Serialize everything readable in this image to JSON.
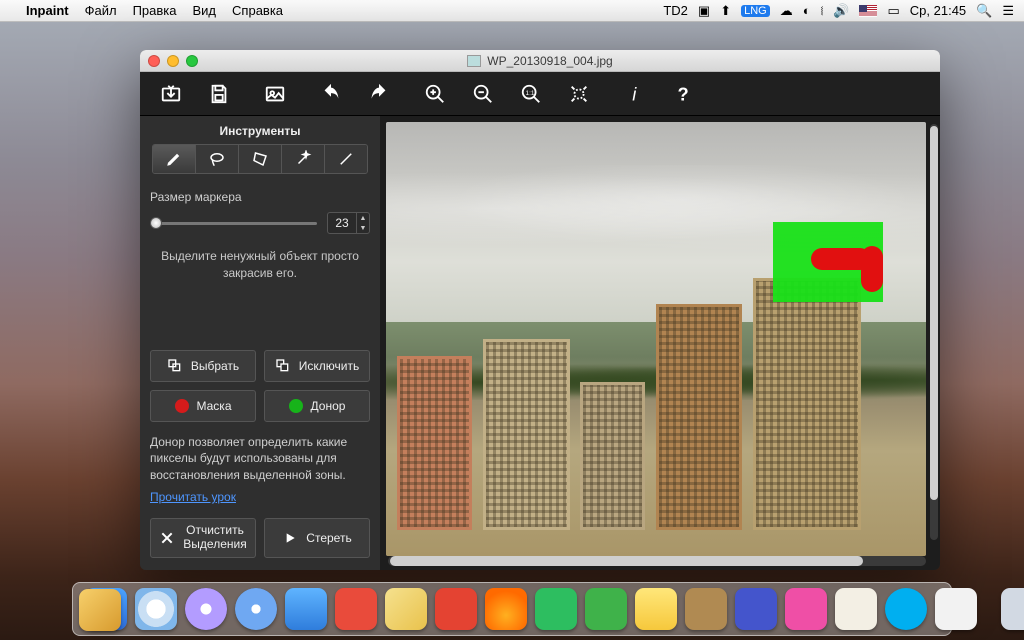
{
  "menubar": {
    "app_name": "Inpaint",
    "items": [
      "Файл",
      "Правка",
      "Вид",
      "Справка"
    ],
    "right": {
      "td2": "D2",
      "lng": "LNG",
      "clock": "Ср, 21:45"
    }
  },
  "window": {
    "title": "WP_20130918_004.jpg"
  },
  "toolbar_icons": [
    "open",
    "save",
    "export",
    "undo",
    "redo",
    "zoom-in",
    "zoom-out",
    "zoom-1-1",
    "fit",
    "info",
    "help"
  ],
  "sidebar": {
    "tools_header": "Инструменты",
    "marker_size_label": "Размер маркера",
    "marker_size_value": "23",
    "hint1": "Выделите ненужный объект просто закрасив его.",
    "select_label": "Выбрать",
    "exclude_label": "Исключить",
    "mask_label": "Маска",
    "donor_label": "Донор",
    "donor_info": "Донор позволяет определить какие пикселы будут использованы для восстановления выделенной зоны.",
    "read_lesson": "Прочитать урок",
    "clear_selection_l1": "Отчистить",
    "clear_selection_l2": "Выделения",
    "erase_label": "Стереть"
  },
  "colors": {
    "mask": "#e11010",
    "donor": "#18e018"
  }
}
